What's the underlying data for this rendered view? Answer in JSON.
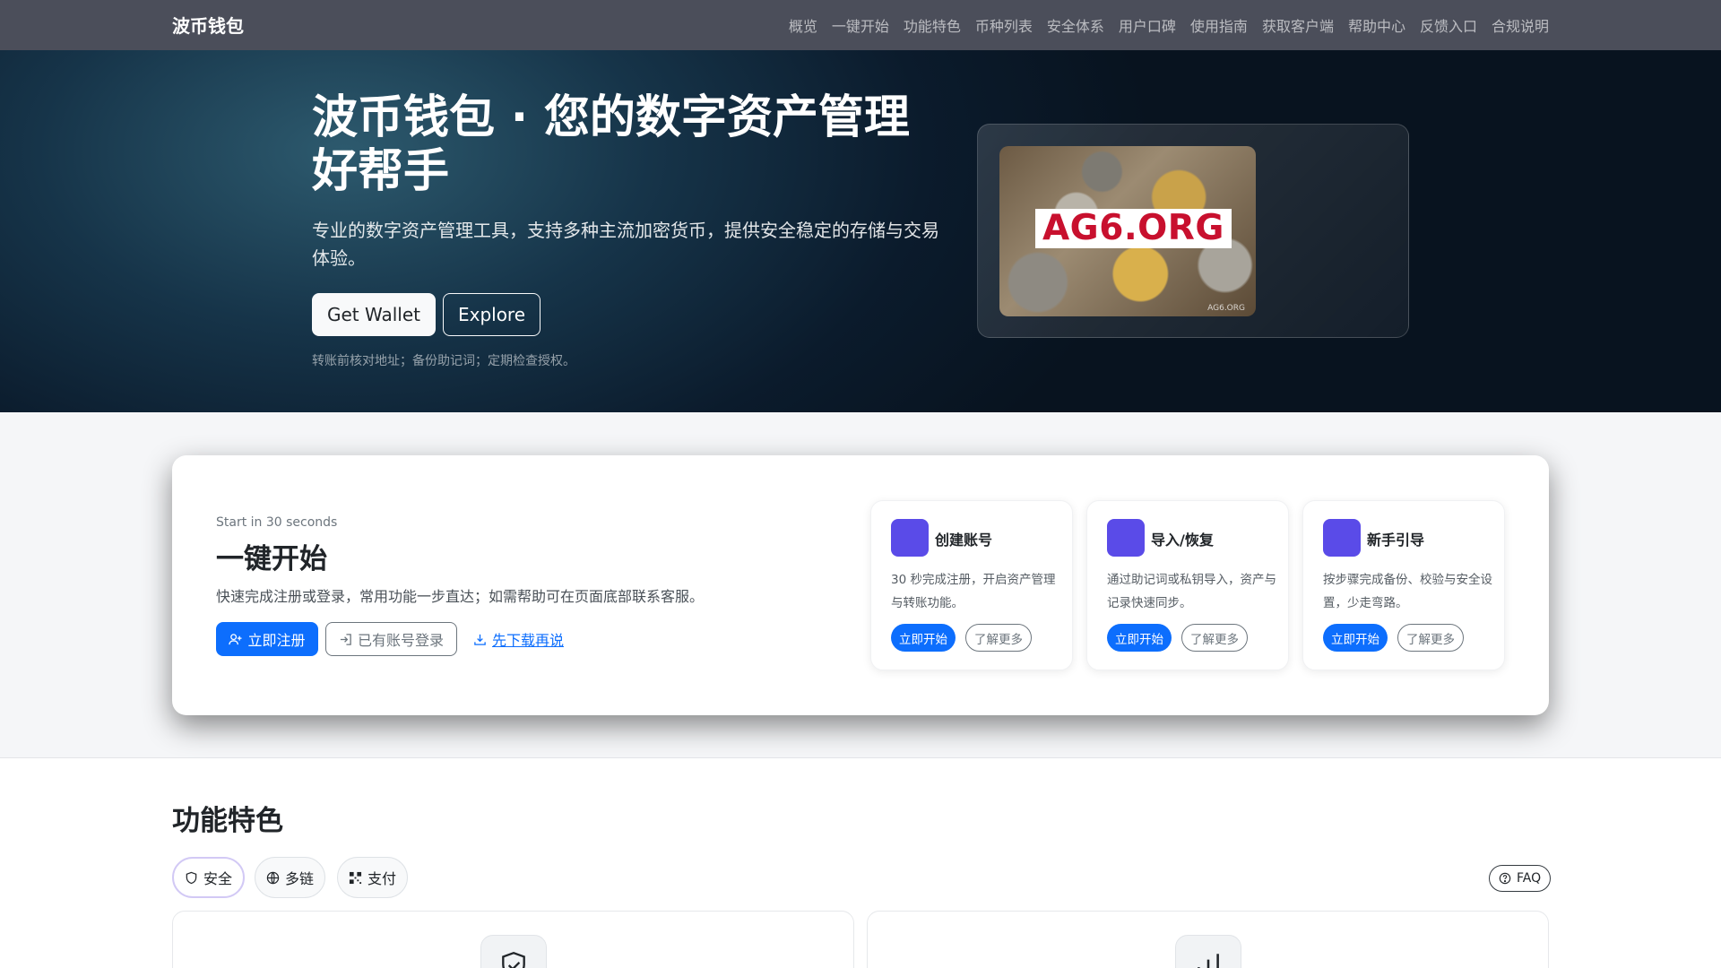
{
  "navbar": {
    "brand": "波币钱包",
    "links": [
      "概览",
      "一键开始",
      "功能特色",
      "币种列表",
      "安全体系",
      "用户口碑",
      "使用指南",
      "获取客户端",
      "帮助中心",
      "反馈入口",
      "合规说明"
    ]
  },
  "hero": {
    "title": "波币钱包 · 您的数字资产管理好帮手",
    "description": "专业的数字资产管理工具，支持多种主流加密货币，提供安全稳定的存储与交易体验。",
    "primary_button": "Get Wallet",
    "secondary_button": "Explore",
    "note": "转账前核对地址；备份助记词；定期检查授权。",
    "image_label": "AG6.ORG",
    "image_footer": "AG6.ORG"
  },
  "quickstart": {
    "kicker": "Start in 30 seconds",
    "title": "一键开始",
    "description": "快速完成注册或登录，常用功能一步直达；如需帮助可在页面底部联系客服。",
    "register_button": "立即注册",
    "login_button": "已有账号登录",
    "download_link": "先下载再说",
    "steps": [
      {
        "title": "创建账号",
        "desc": "30 秒完成注册，开启资产管理与转账功能。",
        "primary": "立即开始",
        "secondary": "了解更多"
      },
      {
        "title": "导入/恢复",
        "desc": "通过助记词或私钥导入，资产与记录快速同步。",
        "primary": "立即开始",
        "secondary": "了解更多"
      },
      {
        "title": "新手引导",
        "desc": "按步骤完成备份、校验与安全设置，少走弯路。",
        "primary": "立即开始",
        "secondary": "了解更多"
      }
    ]
  },
  "features": {
    "title": "功能特色",
    "tabs": [
      "安全",
      "多链",
      "支付"
    ],
    "faq": "FAQ"
  },
  "colors": {
    "navbar_bg": "#4b4e5a",
    "primary": "#0d6efd",
    "step_badge": "#5a4be8",
    "hero_dark": "#0b1b2c"
  }
}
